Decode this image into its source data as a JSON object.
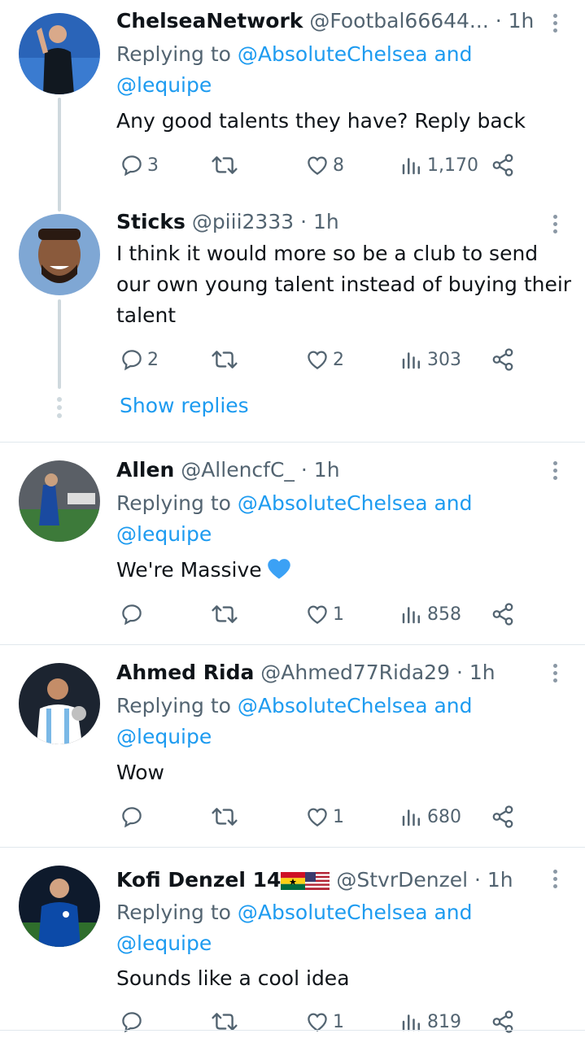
{
  "tweets": [
    {
      "name": "ChelseaNetwork",
      "handle": "@Footbal66644...",
      "time": "1h",
      "reply_prefix": "Replying to",
      "reply_mention": "@AbsoluteChelsea and",
      "reply_mention2": "@lequipe",
      "text": "Any good talents they have? Reply back",
      "replies": "3",
      "retweets": "",
      "likes": "8",
      "views": "1,170"
    },
    {
      "name": "Sticks",
      "handle": "@piii2333",
      "time": "1h",
      "text_lines": [
        "I think it would more so be a club to send",
        "our own young talent instead of buying their",
        "talent"
      ],
      "replies": "2",
      "retweets": "",
      "likes": "2",
      "views": "303"
    },
    {
      "name": "Allen",
      "handle": "@AllencfC_",
      "time": "1h",
      "reply_prefix": "Replying to",
      "reply_mention": "@AbsoluteChelsea and",
      "reply_mention2": "@lequipe",
      "text": "We're Massive",
      "replies": "",
      "retweets": "",
      "likes": "1",
      "views": "858"
    },
    {
      "name": "Ahmed Rida",
      "handle": "@Ahmed77Rida29",
      "time": "1h",
      "reply_prefix": "Replying to",
      "reply_mention": "@AbsoluteChelsea and",
      "reply_mention2": "@lequipe",
      "text": "Wow",
      "replies": "",
      "retweets": "",
      "likes": "1",
      "views": "680"
    },
    {
      "name": "Kofi Denzel 14",
      "handle": "@StvrDenzel",
      "time": "1h",
      "reply_prefix": "Replying to",
      "reply_mention": "@AbsoluteChelsea and",
      "reply_mention2": "@lequipe",
      "text": "Sounds like a cool idea",
      "replies": "",
      "retweets": "",
      "likes": "1",
      "views": "819"
    }
  ],
  "thread": {
    "show_replies": "Show replies"
  },
  "separator": "·",
  "colors": {
    "link": "#1d9bf0",
    "muted": "#536471",
    "text": "#0f1419",
    "thread_line": "#cfd9de"
  },
  "icons": [
    "reply-icon",
    "retweet-icon",
    "like-icon",
    "views-icon",
    "share-icon",
    "more-icon",
    "blue-heart-emoji",
    "ghana-flag-emoji",
    "us-flag-emoji"
  ]
}
